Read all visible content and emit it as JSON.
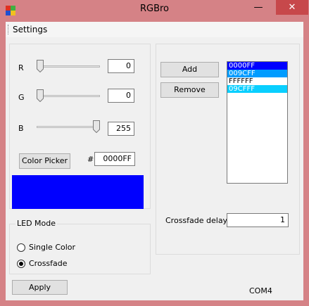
{
  "window": {
    "title": "RGBro",
    "minimize": "—",
    "maximize": "□",
    "close": "✕"
  },
  "menu": {
    "settings": "Settings"
  },
  "rgb": {
    "r_label": "R",
    "g_label": "G",
    "b_label": "B",
    "r_value": "0",
    "g_value": "0",
    "b_value": "255",
    "r_level": 0,
    "g_level": 0,
    "b_level": 1
  },
  "picker": {
    "button": "Color Picker",
    "hash": "#",
    "hex": "0000FF"
  },
  "preview": {
    "color": "#0000ff"
  },
  "list": {
    "add": "Add",
    "remove": "Remove",
    "items": [
      {
        "text": "0000FF",
        "bg": "#0000ff",
        "fg": "#ffffff"
      },
      {
        "text": "009CFF",
        "bg": "#009cff",
        "fg": "#ffffff"
      },
      {
        "text": "FFFFFF",
        "bg": "#ffffff",
        "fg": "#000000"
      },
      {
        "text": "09CFFF",
        "bg": "#09cfff",
        "fg": "#ffffff"
      }
    ]
  },
  "led": {
    "group": "LED Mode",
    "single": "Single Color",
    "crossfade": "Crossfade",
    "selected": "crossfade"
  },
  "crossfade": {
    "label": "Crossfade delay",
    "value": "1"
  },
  "apply": "Apply",
  "port": "COM4"
}
